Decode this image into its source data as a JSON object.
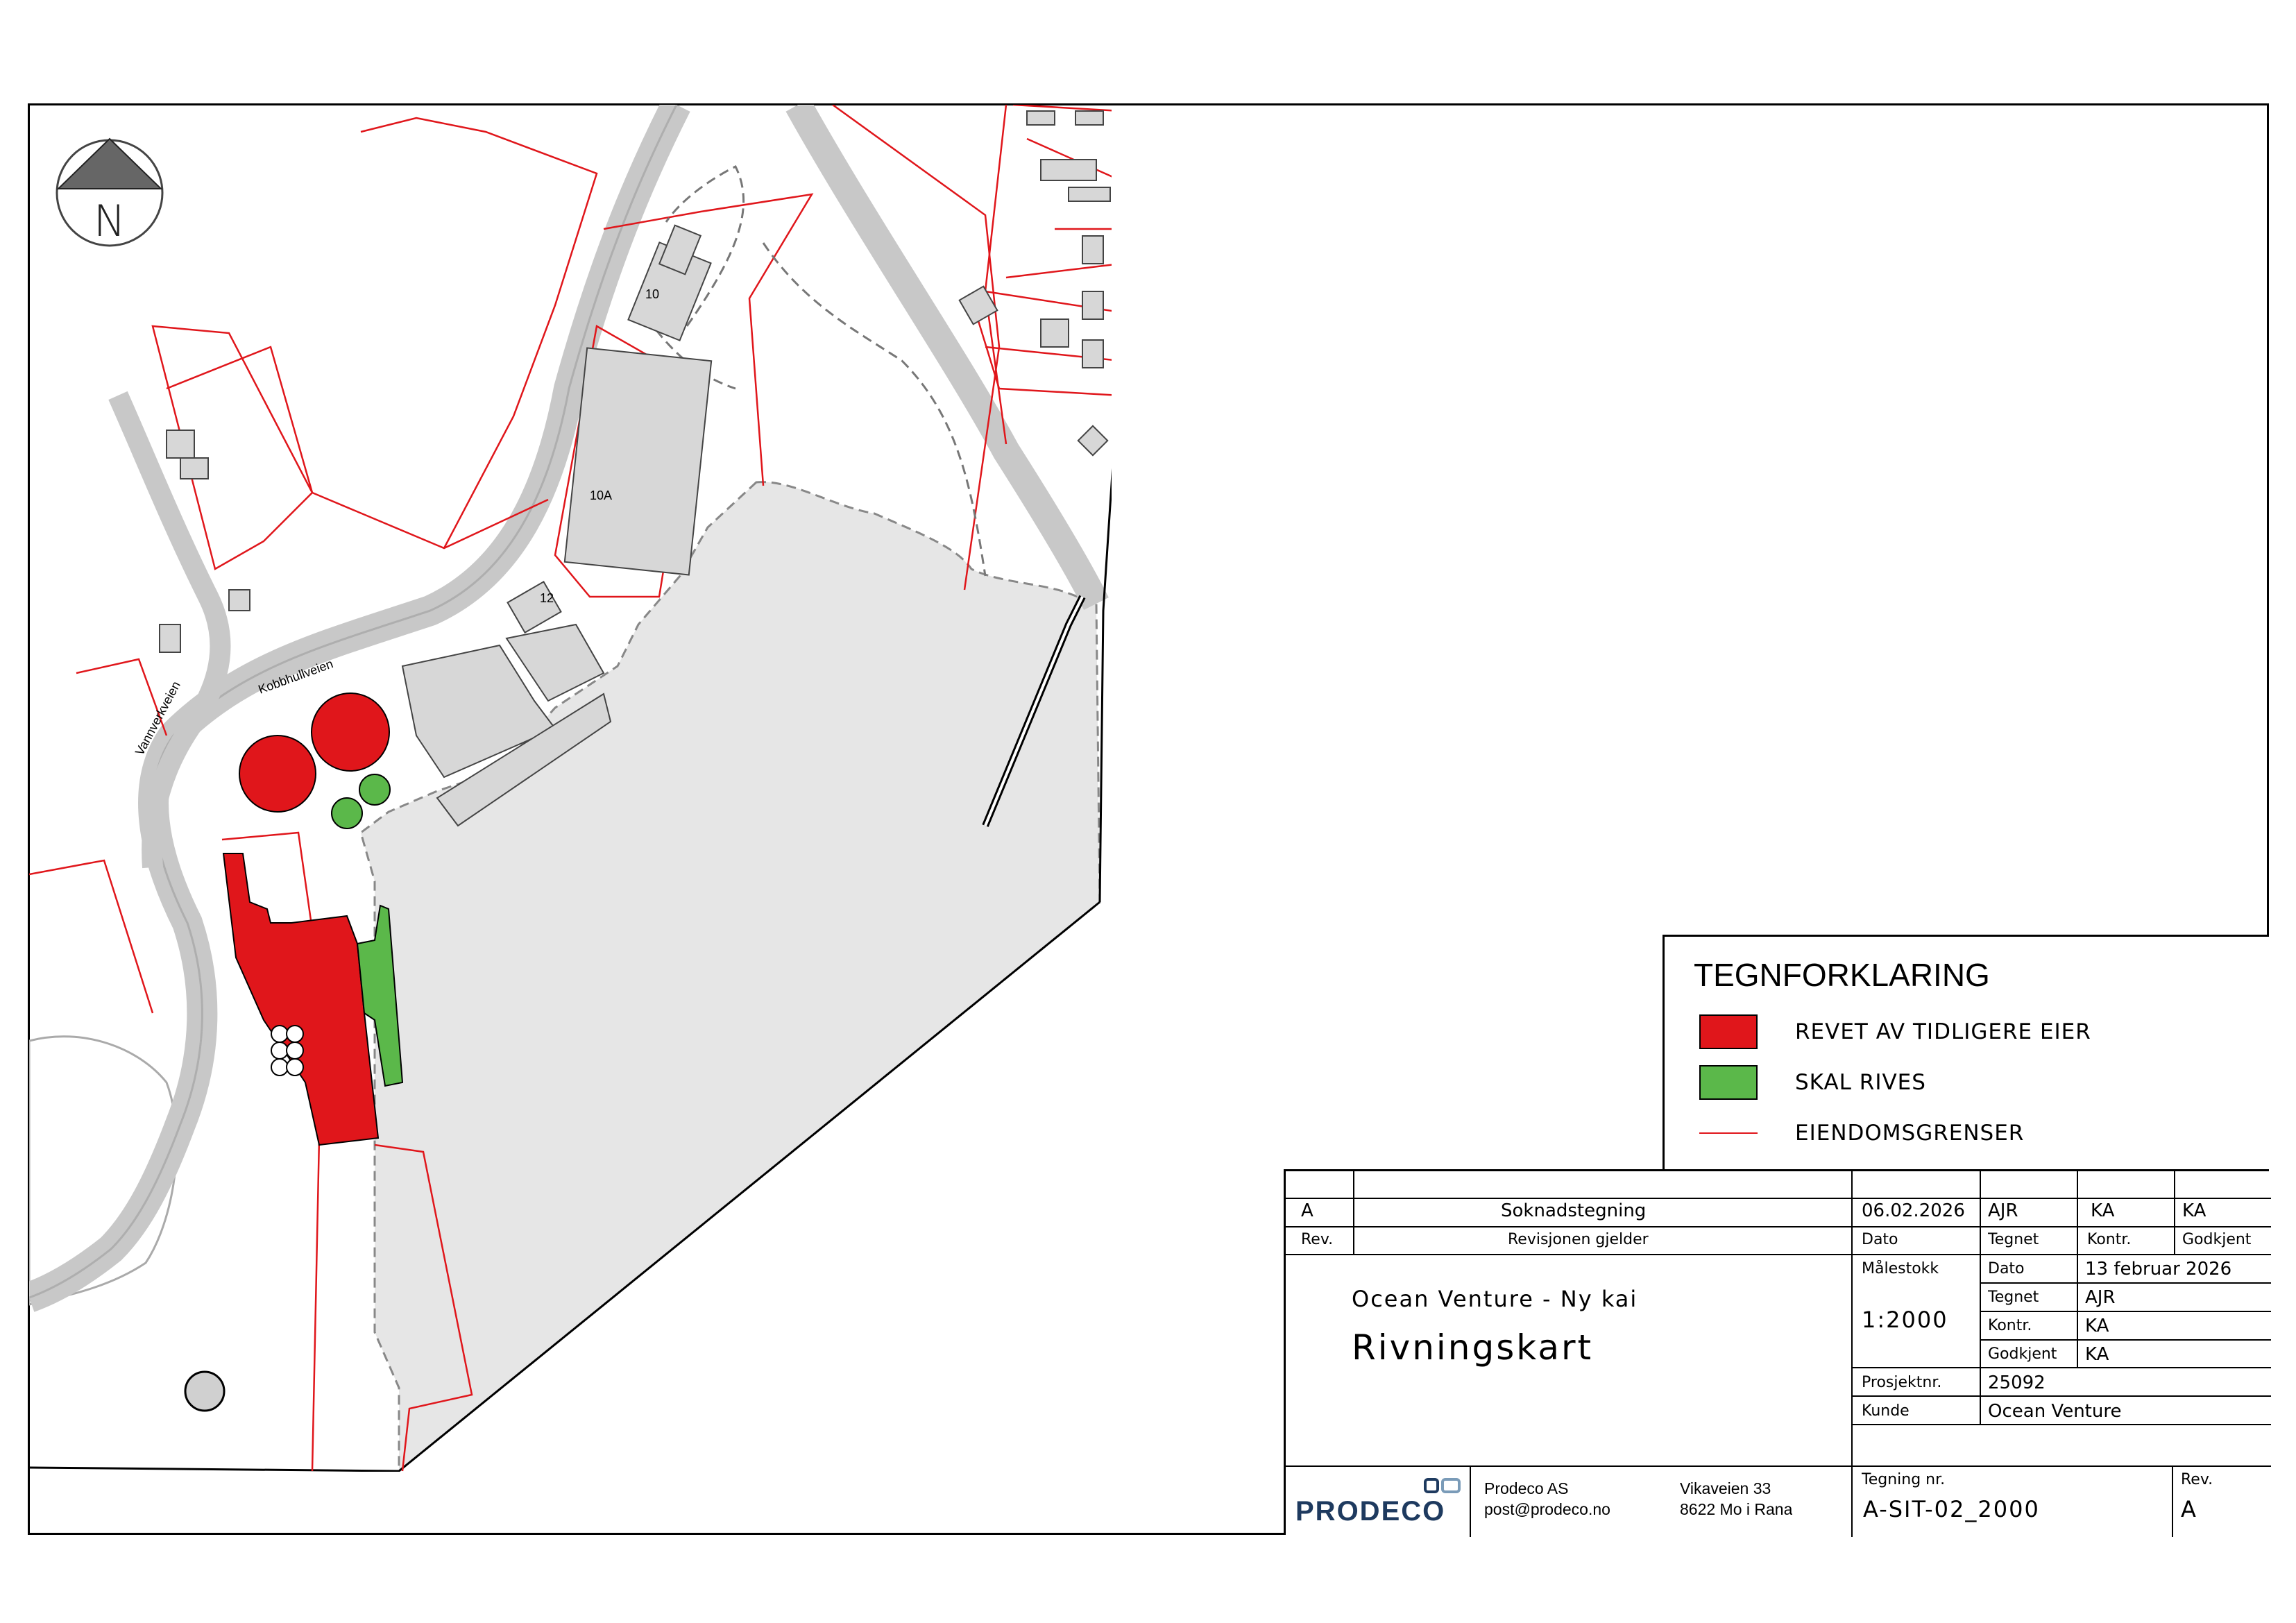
{
  "map": {
    "north_label": "N",
    "road_labels": [
      "Kobbhullveien",
      "Vannverkveien"
    ],
    "building_labels": [
      "10",
      "10A",
      "12"
    ],
    "colors": {
      "removed": "#e0161b",
      "to_demolish": "#5bb84a",
      "boundary": "#e0161b",
      "water": "#e6e6e6",
      "road": "#c8c8c8"
    }
  },
  "legend": {
    "title": "TEGNFORKLARING",
    "items": [
      {
        "label": "REVET AV TIDLIGERE EIER",
        "color": "#e0161b",
        "type": "fill"
      },
      {
        "label": "SKAL RIVES",
        "color": "#5bb84a",
        "type": "fill"
      },
      {
        "label": "EIENDOMSGRENSER",
        "color": "#e0161b",
        "type": "line"
      }
    ]
  },
  "revision": {
    "rev": "A",
    "description": "Soknadstegning",
    "date": "06.02.2026",
    "drawn": "AJR",
    "checked": "KA",
    "approved": "KA",
    "header_rev": "Rev.",
    "header_description": "Revisjonen gjelder",
    "header_date": "Dato",
    "header_drawn": "Tegnet",
    "header_checked": "Kontr.",
    "header_approved": "Godkjent"
  },
  "project": {
    "subtitle": "Ocean Venture - Ny kai",
    "title": "Rivningskart",
    "scale_label": "Målestokk",
    "scale": "1:2000",
    "date_label": "Dato",
    "date": "13 februar 2026",
    "drawn_label": "Tegnet",
    "drawn": "AJR",
    "checked_label": "Kontr.",
    "checked": "KA",
    "approved_label": "Godkjent",
    "approved": "KA",
    "project_no_label": "Prosjektnr.",
    "project_no": "25092",
    "client_label": "Kunde",
    "client": "Ocean Venture"
  },
  "company": {
    "logo_text": "PRODECO",
    "name": "Prodeco AS",
    "email": "post@prodeco.no",
    "street": "Vikaveien 33",
    "city": "8622 Mo i Rana",
    "drawing_no_label": "Tegning nr.",
    "drawing_no": "A-SIT-02_2000",
    "rev_label": "Rev.",
    "rev": "A"
  }
}
